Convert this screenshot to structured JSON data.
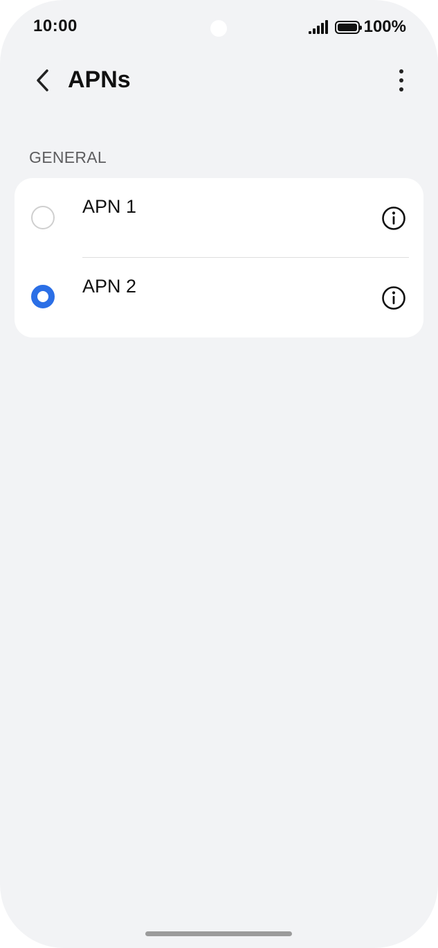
{
  "status_bar": {
    "time": "10:00",
    "battery_text": "100%",
    "signal_icon": "signal-icon",
    "battery_icon": "battery-icon"
  },
  "header": {
    "title": "APNs",
    "back_icon": "chevron-left-icon",
    "more_icon": "more-vert-icon"
  },
  "section": {
    "label": "GENERAL"
  },
  "apns": [
    {
      "name": "APN 1",
      "selected": false
    },
    {
      "name": "APN 2",
      "selected": true
    }
  ],
  "colors": {
    "accent": "#2b6fe6",
    "background": "#f2f3f5",
    "card": "#ffffff"
  }
}
